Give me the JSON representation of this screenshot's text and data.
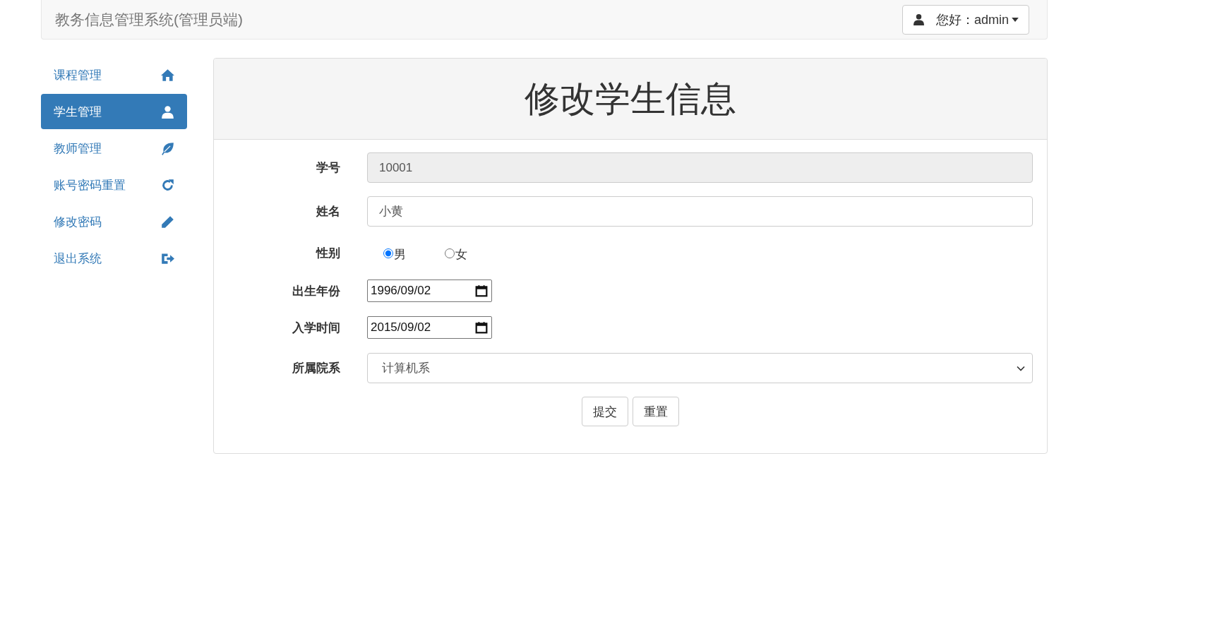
{
  "navbar": {
    "title": "教务信息管理系统(管理员端)",
    "user_menu": {
      "label": "您好：admin"
    }
  },
  "sidebar": {
    "items": [
      {
        "label": "课程管理",
        "selected": false
      },
      {
        "label": "学生管理",
        "selected": true
      },
      {
        "label": "教师管理",
        "selected": false
      },
      {
        "label": "账号密码重置",
        "selected": false
      },
      {
        "label": "修改密码",
        "selected": false
      },
      {
        "label": "退出系统",
        "selected": false
      }
    ]
  },
  "form": {
    "title": "修改学生信息",
    "fields": [
      {
        "kind": "text",
        "label": "学号",
        "value": "10001",
        "disabled": true
      },
      {
        "kind": "text",
        "label": "姓名",
        "value": "小黄",
        "disabled": false
      },
      {
        "kind": "radio",
        "label": "性别",
        "options": [
          {
            "label": "男",
            "selected": true
          },
          {
            "label": "女",
            "selected": false
          }
        ]
      },
      {
        "kind": "date",
        "label": "出生年份",
        "value": "1996/09/02"
      },
      {
        "kind": "date",
        "label": "入学时间",
        "value": "2015/09/02"
      },
      {
        "kind": "select",
        "label": "所属院系",
        "value": "计算机系"
      }
    ],
    "buttons": [
      "提交",
      "重置"
    ]
  }
}
